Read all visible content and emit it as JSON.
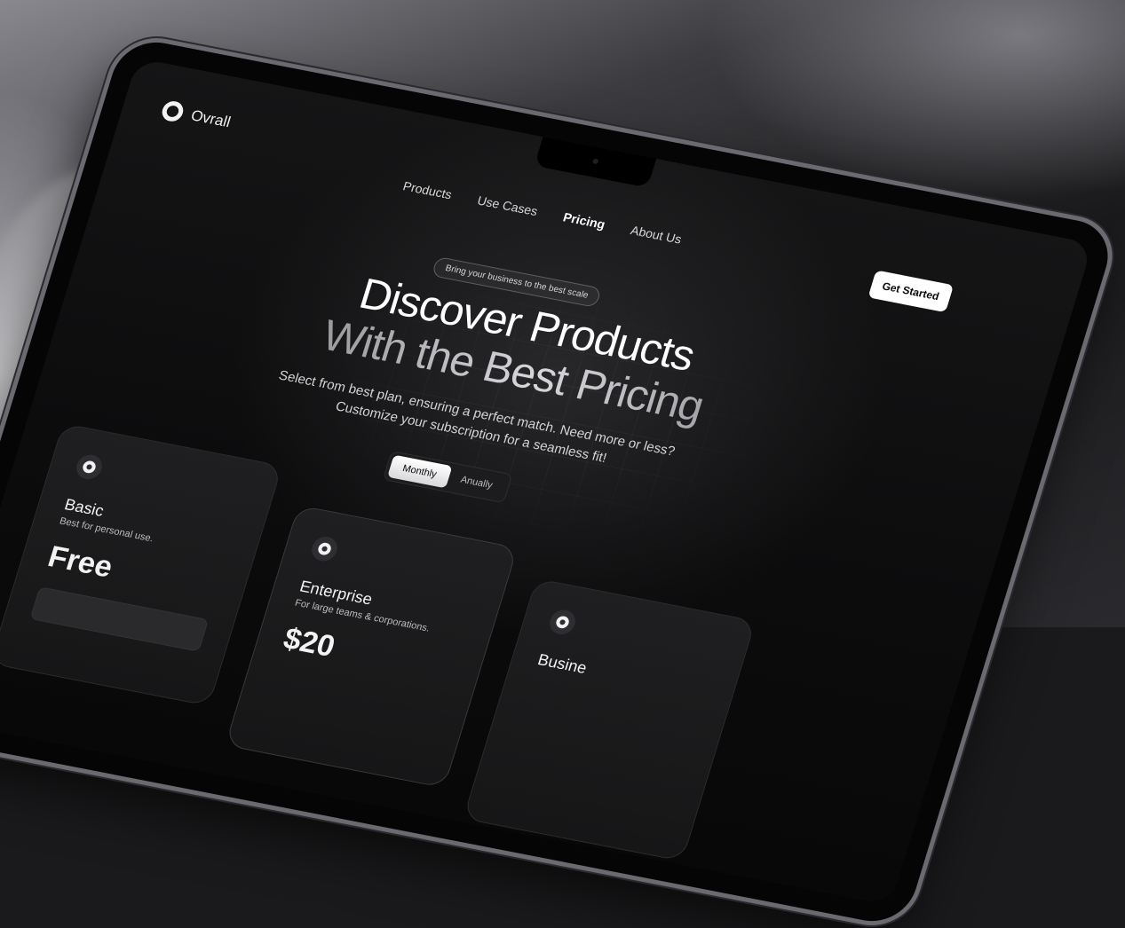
{
  "brand": {
    "name": "Ovrall",
    "logo_icon": "ring-logo-icon"
  },
  "nav": {
    "items": [
      {
        "label": "Products",
        "active": false
      },
      {
        "label": "Use Cases",
        "active": false
      },
      {
        "label": "Pricing",
        "active": true
      },
      {
        "label": "About Us",
        "active": false
      }
    ]
  },
  "cta": {
    "label": "Get Started"
  },
  "hero": {
    "badge": "Bring your business to the best scale",
    "title_line1": "Discover Products",
    "title_line2": "With the Best Pricing",
    "subtitle": "Select from best plan, ensuring a perfect match. Need more or less? Customize your subscription for a seamless fit!"
  },
  "billing_toggle": {
    "options": [
      "Monthly",
      "Anually"
    ],
    "selected": "Monthly"
  },
  "plans": [
    {
      "name": "Basic",
      "description": "Best for personal use.",
      "price": "Free"
    },
    {
      "name": "Enterprise",
      "description": "For large teams & corporations.",
      "price": "$20"
    },
    {
      "name": "Busine",
      "description": "",
      "price": ""
    }
  ],
  "colors": {
    "accent": "#ffffff",
    "background": "#0c0c0d",
    "card": "#1c1c1e"
  }
}
